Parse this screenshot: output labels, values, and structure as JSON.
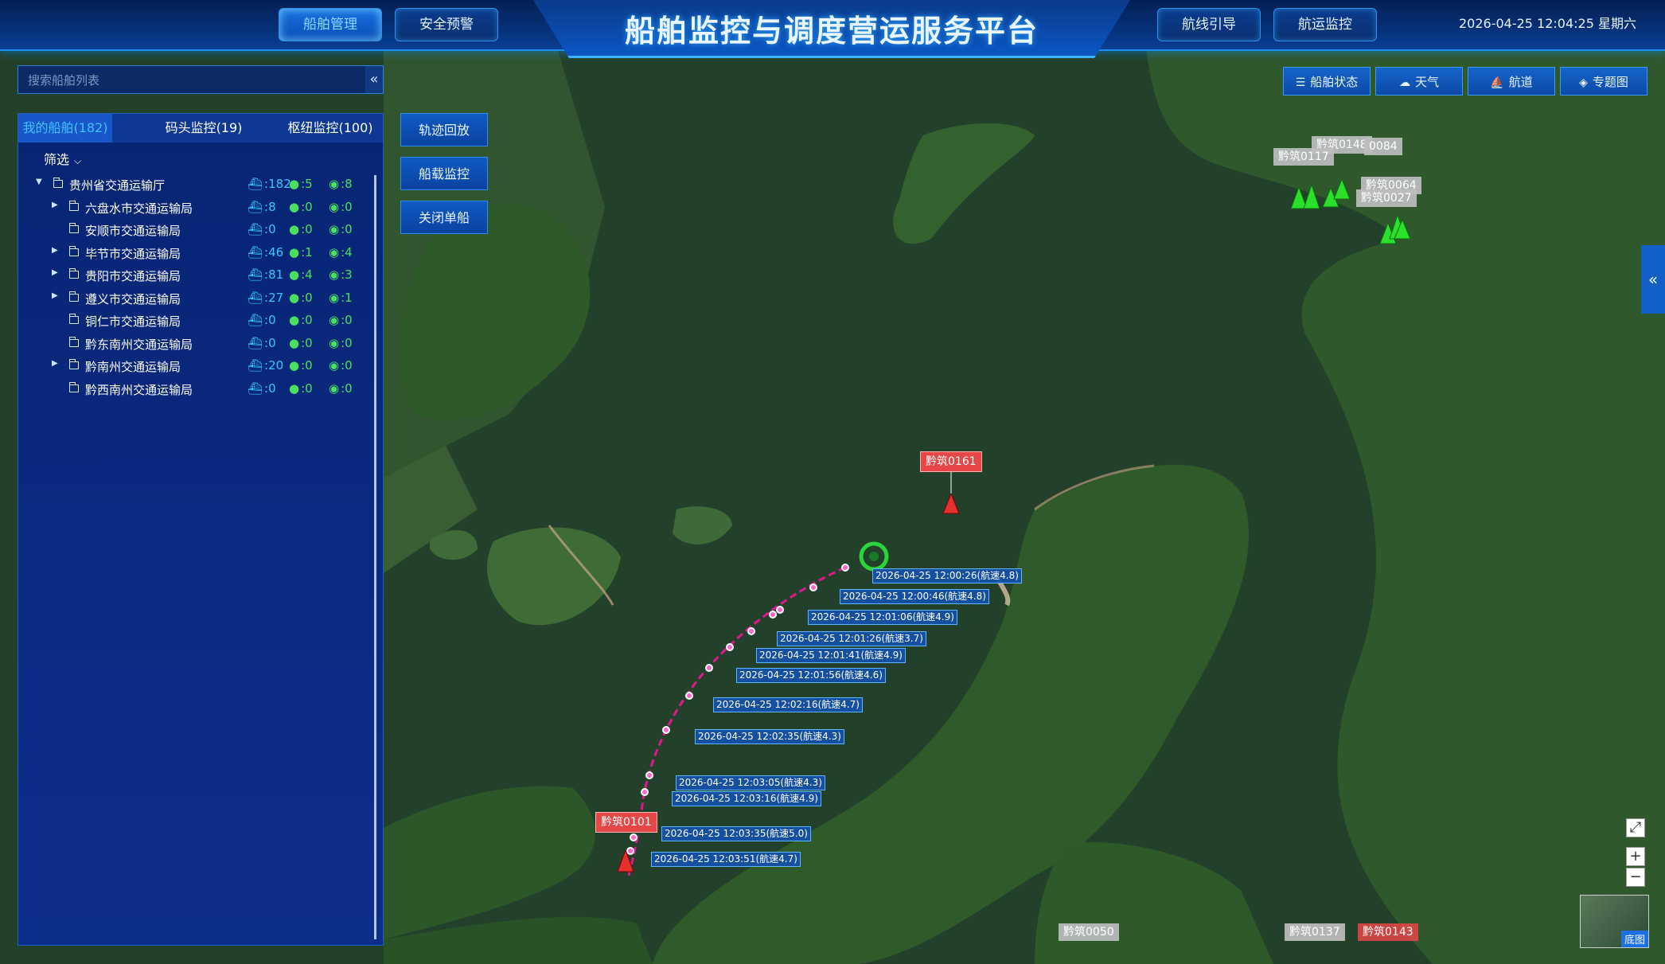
{
  "header": {
    "title": "船舶监控与调度营运服务平台",
    "nav_left": [
      {
        "label": "船舶管理",
        "active": true
      },
      {
        "label": "安全预警",
        "active": false
      }
    ],
    "nav_right": [
      {
        "label": "航线引导"
      },
      {
        "label": "航运监控"
      }
    ],
    "datetime": "2026-04-25 12:04:25 星期六"
  },
  "sidebar": {
    "search_placeholder": "搜索船舶列表",
    "collapse_glyph": "«",
    "tabs": [
      "我的船舶(182)",
      "码头监控(19)",
      "枢纽监控(100)"
    ],
    "filter_label": "筛选",
    "tree": [
      {
        "name": "贵州省交通运输厅",
        "a": "182",
        "b": "5",
        "c": "8",
        "level": 0,
        "arrow": "down"
      },
      {
        "name": "六盘水市交通运输局",
        "a": "8",
        "b": "0",
        "c": "0",
        "level": 1,
        "arrow": "right"
      },
      {
        "name": "安顺市交通运输局",
        "a": "0",
        "b": "0",
        "c": "0",
        "level": 1,
        "arrow": "none"
      },
      {
        "name": "毕节市交通运输局",
        "a": "46",
        "b": "1",
        "c": "4",
        "level": 1,
        "arrow": "right"
      },
      {
        "name": "贵阳市交通运输局",
        "a": "81",
        "b": "4",
        "c": "3",
        "level": 1,
        "arrow": "right"
      },
      {
        "name": "遵义市交通运输局",
        "a": "27",
        "b": "0",
        "c": "1",
        "level": 1,
        "arrow": "right"
      },
      {
        "name": "铜仁市交通运输局",
        "a": "0",
        "b": "0",
        "c": "0",
        "level": 1,
        "arrow": "none"
      },
      {
        "name": "黔东南州交通运输局",
        "a": "0",
        "b": "0",
        "c": "0",
        "level": 1,
        "arrow": "none"
      },
      {
        "name": "黔南州交通运输局",
        "a": "20",
        "b": "0",
        "c": "0",
        "level": 1,
        "arrow": "right"
      },
      {
        "name": "黔西南州交通运输局",
        "a": "0",
        "b": "0",
        "c": "0",
        "level": 1,
        "arrow": "none"
      }
    ]
  },
  "actions": [
    "轨迹回放",
    "船载监控",
    "关闭单船"
  ],
  "map_toolbar": [
    {
      "label": "船舶状态",
      "icon": "list-icon"
    },
    {
      "label": "天气",
      "icon": "weather-icon"
    },
    {
      "label": "航道",
      "icon": "channel-icon"
    },
    {
      "label": "专题图",
      "icon": "layers-icon"
    }
  ],
  "map": {
    "ships_red": [
      "黔筑0161",
      "黔筑0101"
    ],
    "ships_gray": [
      "黔筑0148",
      "0084",
      "黔筑0117",
      "黔筑0064",
      "黔筑0027",
      "黔筑0050",
      "黔筑0137",
      "黔筑0143"
    ],
    "track_points": [
      "2026-04-25 12:00:26(航速4.8)",
      "2026-04-25 12:00:46(航速4.8)",
      "2026-04-25 12:01:06(航速4.9)",
      "2026-04-25 12:01:26(航速3.7)",
      "2026-04-25 12:01:41(航速4.9)",
      "2026-04-25 12:01:56(航速4.6)",
      "2026-04-25 12:02:16(航速4.7)",
      "2026-04-25 12:02:35(航速4.3)",
      "2026-04-25 12:03:05(航速4.3)",
      "2026-04-25 12:03:16(航速4.9)",
      "2026-04-25 12:03:35(航速5.0)",
      "2026-04-25 12:03:51(航速4.7)"
    ],
    "basemap_label": "底图",
    "zoom_in": "+",
    "zoom_out": "−",
    "fullscreen": "⤢",
    "right_tab_glyph": "«"
  },
  "colors": {
    "accent": "#1e8ff0",
    "track": "#e0188f",
    "ship_red": "#e64646",
    "ship_green": "#2be02b"
  }
}
